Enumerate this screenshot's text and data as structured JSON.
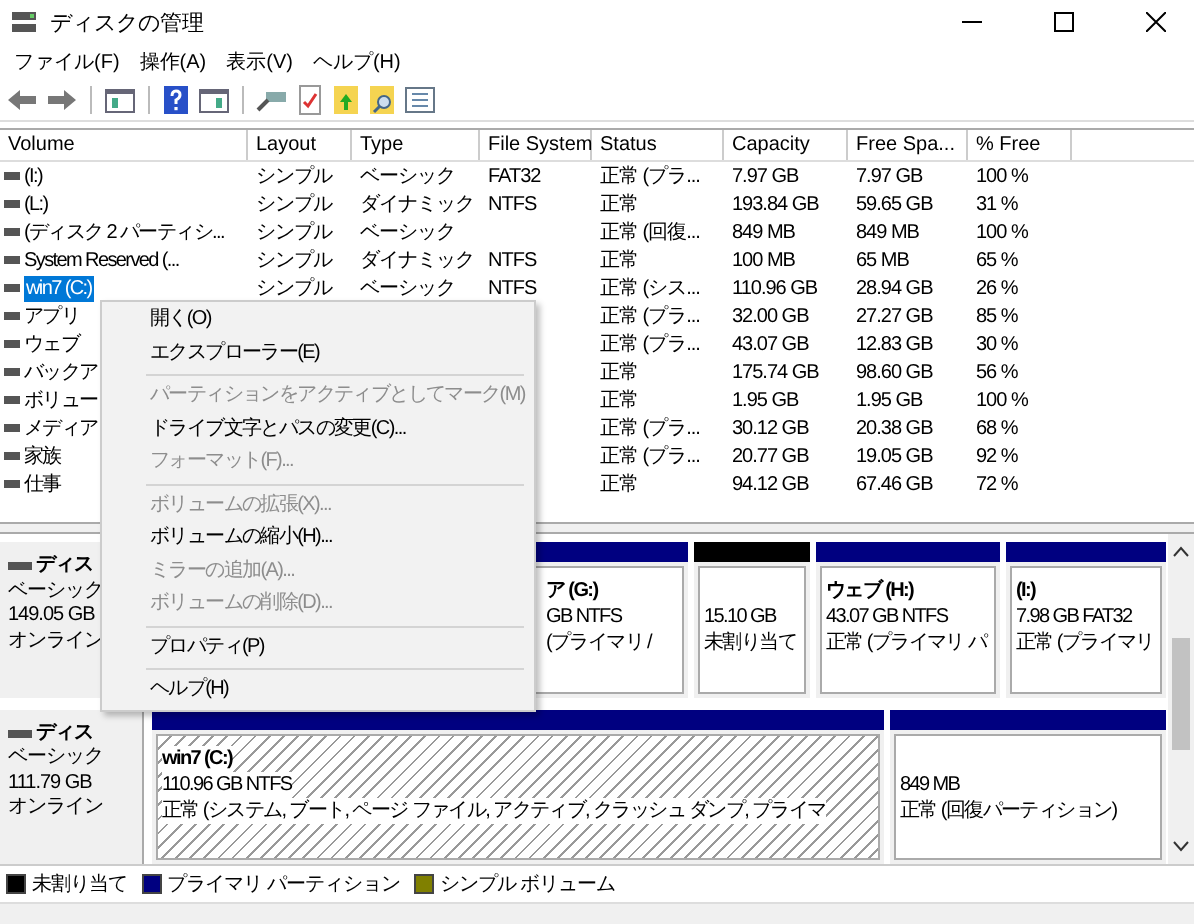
{
  "window": {
    "title": "ディスクの管理"
  },
  "menu": [
    "ファイル(F)",
    "操作(A)",
    "表示(V)",
    "ヘルプ(H)"
  ],
  "table": {
    "columns": [
      "Volume",
      "Layout",
      "Type",
      "File System",
      "Status",
      "Capacity",
      "Free Spa...",
      "% Free"
    ],
    "rows": [
      {
        "cells": [
          "(I:)",
          "シンプル",
          "ベーシック",
          "FAT32",
          "正常 (プラ...",
          "7.97 GB",
          "7.97 GB",
          "100 %"
        ],
        "selected": false
      },
      {
        "cells": [
          "(L:)",
          "シンプル",
          "ダイナミック",
          "NTFS",
          "正常",
          "193.84 GB",
          "59.65 GB",
          "31 %"
        ],
        "selected": false
      },
      {
        "cells": [
          "(ディスク 2 パーティシ...",
          "シンプル",
          "ベーシック",
          "",
          "正常 (回復...",
          "849 MB",
          "849 MB",
          "100 %"
        ],
        "selected": false
      },
      {
        "cells": [
          "System Reserved (...",
          "シンプル",
          "ダイナミック",
          "NTFS",
          "正常",
          "100 MB",
          "65 MB",
          "65 %"
        ],
        "selected": false
      },
      {
        "cells": [
          "win7 (C:)",
          "シンプル",
          "ベーシック",
          "NTFS",
          "正常 (シス...",
          "110.96 GB",
          "28.94 GB",
          "26 %"
        ],
        "selected": true
      },
      {
        "cells": [
          "アプリ",
          "",
          "",
          "",
          "正常 (プラ...",
          "32.00 GB",
          "27.27 GB",
          "85 %"
        ],
        "selected": false
      },
      {
        "cells": [
          "ウェブ",
          "",
          "",
          "",
          "正常 (プラ...",
          "43.07 GB",
          "12.83 GB",
          "30 %"
        ],
        "selected": false
      },
      {
        "cells": [
          "バックア",
          "",
          "",
          "",
          "正常",
          "175.74 GB",
          "98.60 GB",
          "56 %"
        ],
        "selected": false
      },
      {
        "cells": [
          "ボリュー",
          "",
          "",
          "",
          "正常",
          "1.95 GB",
          "1.95 GB",
          "100 %"
        ],
        "selected": false
      },
      {
        "cells": [
          "メディア",
          "",
          "",
          "",
          "正常 (プラ...",
          "30.12 GB",
          "20.38 GB",
          "68 %"
        ],
        "selected": false
      },
      {
        "cells": [
          "家族",
          "",
          "",
          "",
          "正常 (プラ...",
          "20.77 GB",
          "19.05 GB",
          "92 %"
        ],
        "selected": false
      },
      {
        "cells": [
          "仕事",
          "",
          "",
          "",
          "正常",
          "94.12 GB",
          "67.46 GB",
          "72 %"
        ],
        "selected": false
      }
    ]
  },
  "disks": [
    {
      "label": "ディス",
      "type": "ベーシック",
      "size": "149.05 GB",
      "state": "オンライン",
      "partitions": [
        {
          "kind": "primary",
          "name": "ア (G:)",
          "size": "GB NTFS",
          "status": "(プライマリ /",
          "selected": false
        },
        {
          "kind": "unallocated",
          "size": "15.10 GB",
          "status": "未割り当て",
          "selected": false
        },
        {
          "kind": "primary",
          "name": "ウェブ (H:)",
          "size": "43.07 GB NTFS",
          "status": "正常 (プライマリ パ",
          "selected": false
        },
        {
          "kind": "primary",
          "name": "(I:)",
          "size": "7.98 GB FAT32",
          "status": "正常 (プライマリ",
          "selected": false
        }
      ]
    },
    {
      "label": "ディス",
      "type": "ベーシック",
      "size": "111.79 GB",
      "state": "オンライン",
      "partitions": [
        {
          "kind": "primary",
          "name": "win7 (C:)",
          "size": "110.96 GB NTFS",
          "status": "正常 (システム, ブート, ページ ファイル, アクティブ, クラッシュ ダンプ, プライマ",
          "selected": true
        },
        {
          "kind": "primary",
          "size": "849 MB",
          "status": "正常 (回復パーティション)",
          "selected": false
        }
      ]
    }
  ],
  "context_menu": [
    {
      "kind": "item",
      "label": "開く(O)",
      "disabled": false
    },
    {
      "kind": "item",
      "label": "エクスプローラー(E)",
      "disabled": false
    },
    {
      "kind": "separator"
    },
    {
      "kind": "item",
      "label": "パーティションをアクティブとしてマーク(M)",
      "disabled": true
    },
    {
      "kind": "item",
      "label": "ドライブ文字とパスの変更(C)...",
      "disabled": false
    },
    {
      "kind": "item",
      "label": "フォーマット(F)...",
      "disabled": true
    },
    {
      "kind": "separator"
    },
    {
      "kind": "item",
      "label": "ボリュームの拡張(X)...",
      "disabled": true
    },
    {
      "kind": "item",
      "label": "ボリュームの縮小(H)...",
      "disabled": false
    },
    {
      "kind": "item",
      "label": "ミラーの追加(A)...",
      "disabled": true
    },
    {
      "kind": "item",
      "label": "ボリュームの削除(D)...",
      "disabled": true
    },
    {
      "kind": "separator"
    },
    {
      "kind": "item",
      "label": "プロパティ(P)",
      "disabled": false
    },
    {
      "kind": "separator"
    },
    {
      "kind": "item",
      "label": "ヘルプ(H)",
      "disabled": false
    }
  ],
  "legend": [
    {
      "label": "未割り当て",
      "color": "#000000"
    },
    {
      "label": "プライマリ パーティション",
      "color": "#000080"
    },
    {
      "label": "シンプル ボリューム",
      "color": "#808000"
    }
  ]
}
